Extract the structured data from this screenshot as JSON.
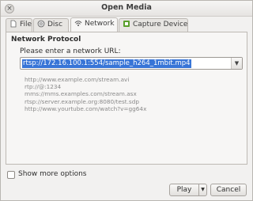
{
  "window": {
    "title": "Open Media"
  },
  "tabs": [
    {
      "label": "File",
      "icon": "file-icon",
      "active": false
    },
    {
      "label": "Disc",
      "icon": "disc-icon",
      "active": false
    },
    {
      "label": "Network",
      "icon": "network-icon",
      "active": true
    },
    {
      "label": "Capture Device",
      "icon": "capture-icon",
      "active": false
    }
  ],
  "network": {
    "section_title": "Network Protocol",
    "url_label": "Please enter a network URL:",
    "url_value": "rtsp://172.16.100.1:554/sample_h264_1mbit.mp4",
    "examples": [
      "http://www.example.com/stream.avi",
      "rtp://@:1234",
      "mms://mms.examples.com/stream.asx",
      "rtsp://server.example.org:8080/test.sdp",
      "http://www.yourtube.com/watch?v=gg64x"
    ]
  },
  "options": {
    "show_more_label": "Show more options"
  },
  "buttons": {
    "play_label": "Play",
    "cancel_label": "Cancel"
  },
  "colors": {
    "selection": "#3875d7",
    "accent_green": "#5aa02c"
  }
}
